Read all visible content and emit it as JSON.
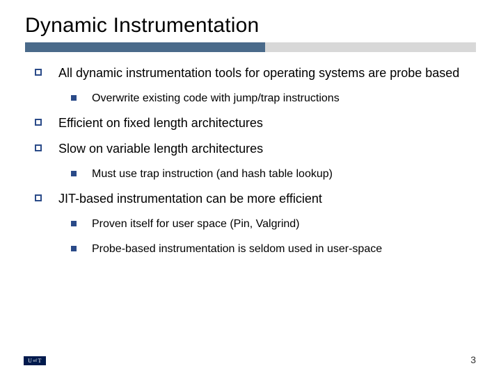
{
  "title": "Dynamic Instrumentation",
  "bullets": {
    "b1": "All dynamic instrumentation tools for operating systems are probe based",
    "b1_1": "Overwrite existing code with jump/trap instructions",
    "b2": "Efficient on fixed length architectures",
    "b3": "Slow on variable length architectures",
    "b3_1": "Must use trap instruction (and hash table lookup)",
    "b4": "JIT-based instrumentation can be more efficient",
    "b4_1": "Proven itself for user space (Pin, Valgrind)",
    "b4_2": "Probe-based instrumentation is seldom used in user-space"
  },
  "logo_text": "U of T",
  "page_number": "3"
}
